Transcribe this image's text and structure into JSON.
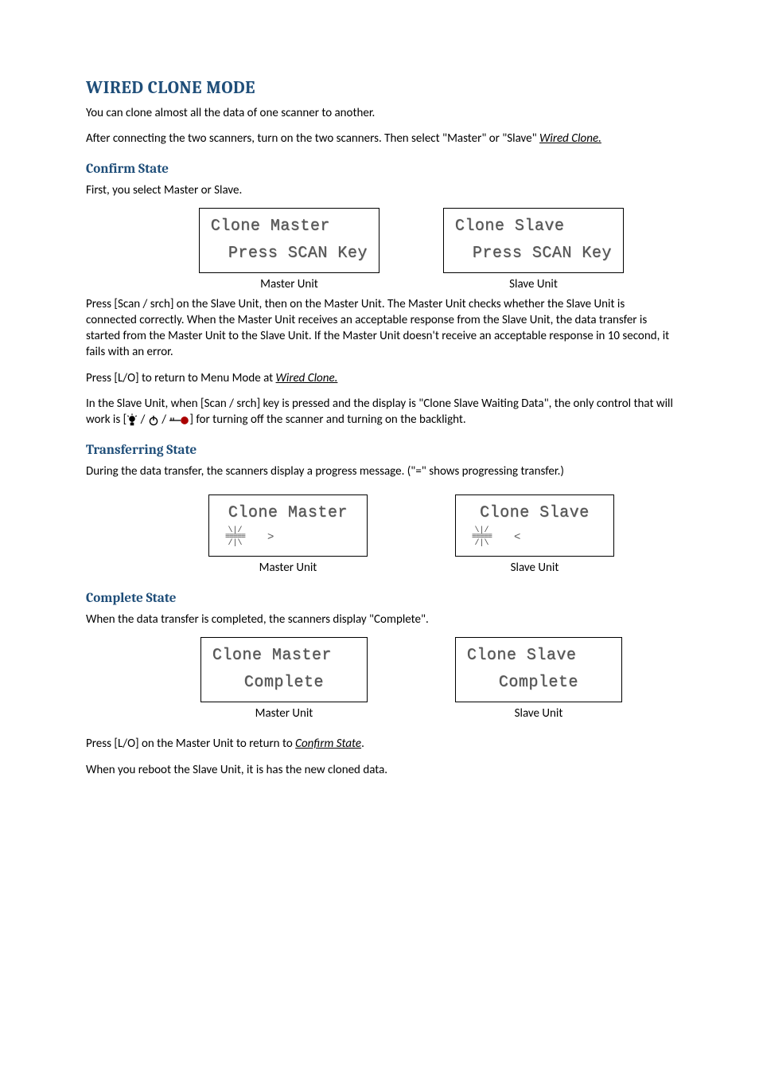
{
  "headings": {
    "h1": "WIRED CLONE MODE",
    "confirm": "Confirm State",
    "transferring": "Transferring State",
    "complete": "Complete State"
  },
  "paras": {
    "intro1": "You can clone almost all the data of one scanner to another.",
    "intro2_a": "After connecting the two scanners, turn on the two scanners. Then select \"Master\" or \"Slave\"  ",
    "intro2_link": "Wired Clone.",
    "confirm_first": "First, you select Master or Slave.",
    "confirm_body": "Press [Scan / srch] on the Slave Unit, then on the Master Unit. The Master Unit checks whether the Slave Unit is connected correctly. When the Master Unit receives an acceptable response from the Slave Unit, the data transfer is started from the Master Unit to the Slave Unit. If the Master Unit doesn't receive an acceptable response in 10 second, it fails with an error.",
    "press_lo_a": "Press [L/O] to return to Menu Mode at ",
    "press_lo_link": "Wired Clone.",
    "slave_wait_a": "In the Slave Unit, when [Scan / srch] key is pressed and the display is \"Clone Slave Waiting Data\", the only control that will work is [",
    "slave_wait_b": "] for turning off the scanner and turning on the backlight.",
    "transfer_body": "During the data transfer, the scanners display a progress message. (\"=\" shows progressing transfer.)",
    "complete_body": "When the data transfer is completed, the scanners display \"Complete\".",
    "press_lo_master_a": "Press [L/O] on the Master Unit to return to ",
    "press_lo_master_link": "Confirm State",
    "press_lo_master_b": ".",
    "reboot": "When you reboot the Slave Unit, it is has the new cloned data."
  },
  "captions": {
    "master": "Master Unit",
    "slave": "Slave Unit"
  },
  "lcd": {
    "clone_master": "Clone Master",
    "clone_slave": "Clone Slave",
    "press_scan": "Press SCAN Key",
    "complete": "Complete",
    "sun_top": "\\|/",
    "bar": "≡≡≡≡≡",
    "sun_bot": "/|\\",
    "arrow_r": ">",
    "arrow_l": "<"
  },
  "icons": {
    "bulb": "bulb-icon",
    "power": "power-icon",
    "lock": "lock-key-icon",
    "sep": " / "
  }
}
